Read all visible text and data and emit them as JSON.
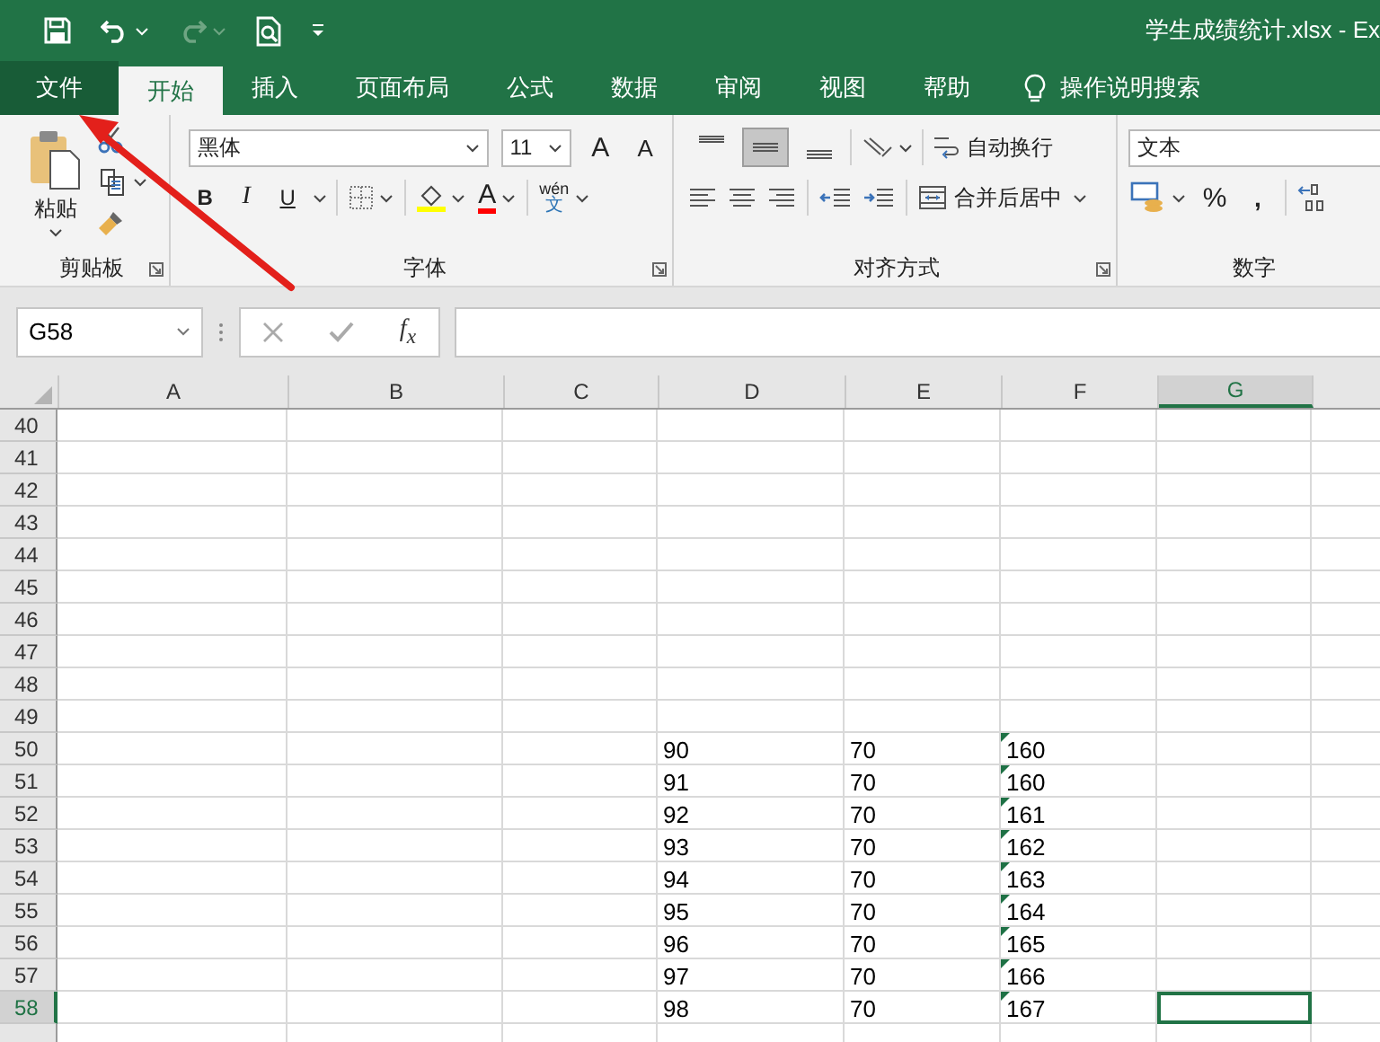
{
  "title_bar": {
    "title": "学生成绩统计.xlsx  -  Ex",
    "redo_disabled": true
  },
  "tabs": [
    {
      "label": "文件",
      "kind": "file",
      "selected": false
    },
    {
      "label": "开始",
      "kind": "tab",
      "selected": true
    },
    {
      "label": "插入",
      "kind": "tab",
      "selected": false
    },
    {
      "label": "页面布局",
      "kind": "tab",
      "selected": false
    },
    {
      "label": "公式",
      "kind": "tab",
      "selected": false
    },
    {
      "label": "数据",
      "kind": "tab",
      "selected": false
    },
    {
      "label": "审阅",
      "kind": "tab",
      "selected": false
    },
    {
      "label": "视图",
      "kind": "tab",
      "selected": false
    },
    {
      "label": "帮助",
      "kind": "tab",
      "selected": false
    }
  ],
  "tell_me": "操作说明搜索",
  "ribbon": {
    "clipboard": {
      "label": "剪贴板",
      "paste": "粘贴"
    },
    "font": {
      "label": "字体",
      "font_name": "黑体",
      "font_size": "11",
      "grow": "A",
      "shrink": "A",
      "bold": "B",
      "italic": "I",
      "underline": "U",
      "font_color": "A",
      "phonetic_top": "wén",
      "phonetic_bottom": "文"
    },
    "alignment": {
      "label": "对齐方式",
      "vertical": [
        {
          "kind": "top",
          "selected": false
        },
        {
          "kind": "middle",
          "selected": true
        },
        {
          "kind": "bottom",
          "selected": false
        }
      ],
      "wrap": "自动换行",
      "merge": "合并后居中"
    },
    "number": {
      "label": "数字",
      "format": "文本",
      "percent": "%",
      "comma": ","
    }
  },
  "formula_bar": {
    "name_box": "G58",
    "fx": "f$_{x}$"
  },
  "sheet": {
    "columns": [
      {
        "label": "A",
        "selected": false
      },
      {
        "label": "B",
        "selected": false
      },
      {
        "label": "C",
        "selected": false
      },
      {
        "label": "D",
        "selected": false
      },
      {
        "label": "E",
        "selected": false
      },
      {
        "label": "F",
        "selected": false
      },
      {
        "label": "G",
        "selected": true
      }
    ],
    "rows": [
      {
        "number": "40",
        "selected": false
      },
      {
        "number": "41",
        "selected": false
      },
      {
        "number": "42",
        "selected": false
      },
      {
        "number": "43",
        "selected": false
      },
      {
        "number": "44",
        "selected": false
      },
      {
        "number": "45",
        "selected": false
      },
      {
        "number": "46",
        "selected": false
      },
      {
        "number": "47",
        "selected": false
      },
      {
        "number": "48",
        "selected": false
      },
      {
        "number": "49",
        "selected": false
      },
      {
        "number": "50",
        "selected": false,
        "cells": [
          {
            "value": "90",
            "flag": false
          },
          {
            "value": "70",
            "flag": false
          },
          {
            "value": "160",
            "flag": true
          }
        ]
      },
      {
        "number": "51",
        "selected": false,
        "cells": [
          {
            "value": "91",
            "flag": false
          },
          {
            "value": "70",
            "flag": false
          },
          {
            "value": "160",
            "flag": true
          }
        ]
      },
      {
        "number": "52",
        "selected": false,
        "cells": [
          {
            "value": "92",
            "flag": false
          },
          {
            "value": "70",
            "flag": false
          },
          {
            "value": "161",
            "flag": true
          }
        ]
      },
      {
        "number": "53",
        "selected": false,
        "cells": [
          {
            "value": "93",
            "flag": false
          },
          {
            "value": "70",
            "flag": false
          },
          {
            "value": "162",
            "flag": true
          }
        ]
      },
      {
        "number": "54",
        "selected": false,
        "cells": [
          {
            "value": "94",
            "flag": false
          },
          {
            "value": "70",
            "flag": false
          },
          {
            "value": "163",
            "flag": true
          }
        ]
      },
      {
        "number": "55",
        "selected": false,
        "cells": [
          {
            "value": "95",
            "flag": false
          },
          {
            "value": "70",
            "flag": false
          },
          {
            "value": "164",
            "flag": true
          }
        ]
      },
      {
        "number": "56",
        "selected": false,
        "cells": [
          {
            "value": "96",
            "flag": false
          },
          {
            "value": "70",
            "flag": false
          },
          {
            "value": "165",
            "flag": true
          }
        ]
      },
      {
        "number": "57",
        "selected": false,
        "cells": [
          {
            "value": "97",
            "flag": false
          },
          {
            "value": "70",
            "flag": false
          },
          {
            "value": "166",
            "flag": true
          }
        ]
      },
      {
        "number": "58",
        "selected": true,
        "cells": [
          {
            "value": "98",
            "flag": false
          },
          {
            "value": "70",
            "flag": false
          },
          {
            "value": "167",
            "flag": true
          }
        ]
      }
    ]
  }
}
